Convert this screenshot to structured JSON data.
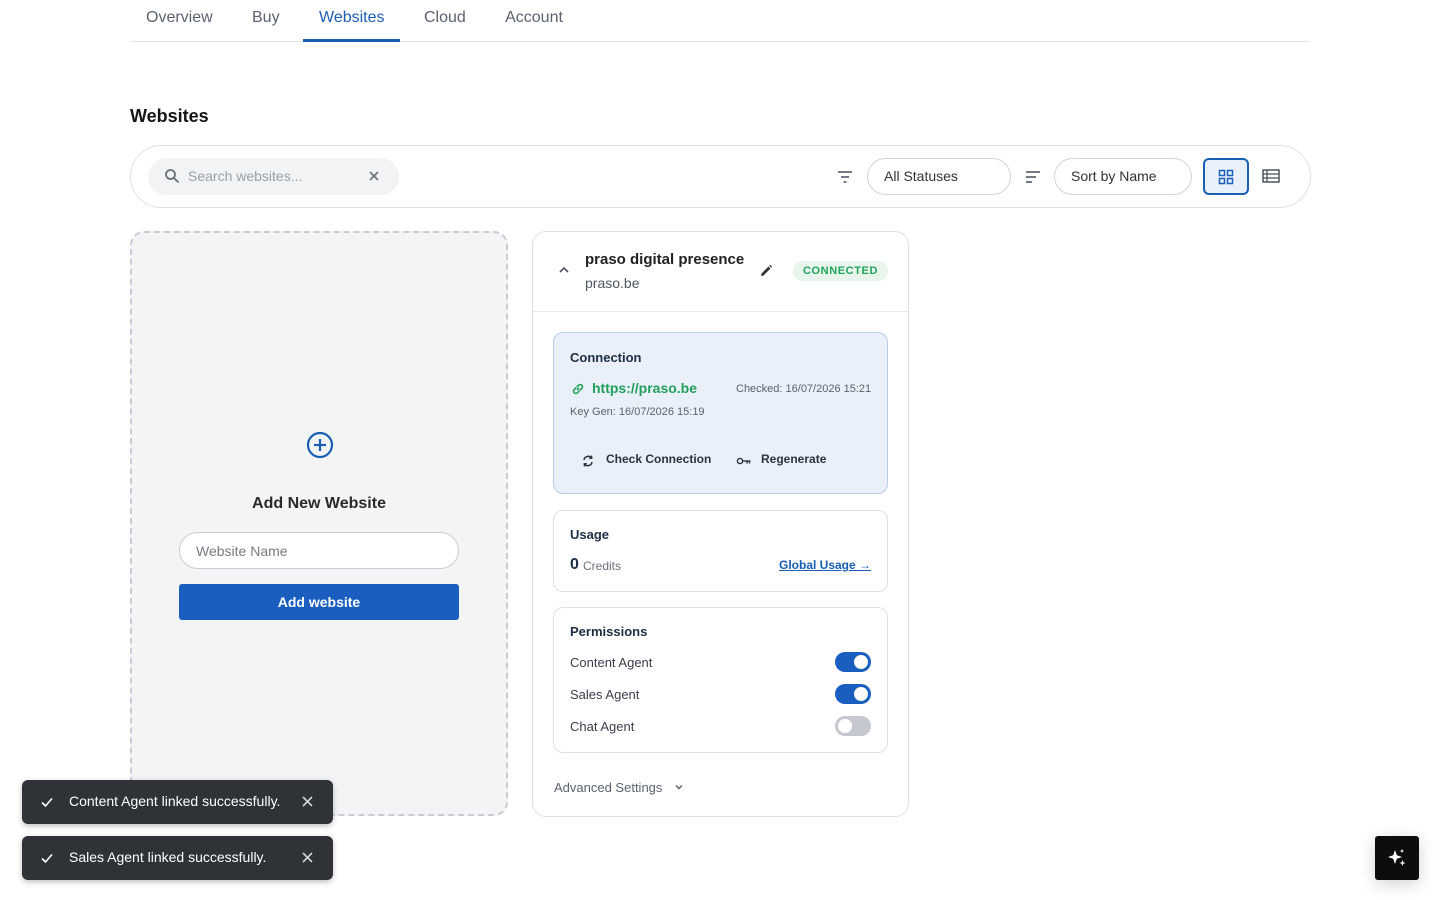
{
  "tabs": [
    {
      "label": "Overview"
    },
    {
      "label": "Buy"
    },
    {
      "label": "Websites"
    },
    {
      "label": "Cloud"
    },
    {
      "label": "Account"
    }
  ],
  "active_tab": "Websites",
  "section_title": "Websites",
  "toolbar": {
    "search_placeholder": "Search websites...",
    "status_filter": "All Statuses",
    "sort": "Sort by Name",
    "view_mode": "grid"
  },
  "add_card": {
    "title": "Add New Website",
    "name_placeholder": "Website Name",
    "button_label": "Add website"
  },
  "website": {
    "name": "praso digital presence",
    "domain": "praso.be",
    "status": "CONNECTED",
    "connection": {
      "title": "Connection",
      "url": "https://praso.be",
      "checked": "Checked: 16/07/2026 15:21",
      "key_gen": "Key Gen: 16/07/2026 15:19",
      "check_label": "Check Connection",
      "regenerate_label": "Regenerate"
    },
    "usage": {
      "title": "Usage",
      "value": "0",
      "unit": "Credits",
      "link": "Global Usage →"
    },
    "permissions": {
      "title": "Permissions",
      "items": [
        {
          "label": "Content Agent",
          "enabled": true
        },
        {
          "label": "Sales Agent",
          "enabled": true
        },
        {
          "label": "Chat Agent",
          "enabled": false
        }
      ]
    },
    "advanced_label": "Advanced Settings"
  },
  "toasts": [
    {
      "message": "Content Agent linked successfully."
    },
    {
      "message": "Sales Agent linked successfully."
    }
  ],
  "colors": {
    "primary": "#1a5fc0",
    "success": "#21a35a",
    "toast_bg": "#2f3338"
  }
}
